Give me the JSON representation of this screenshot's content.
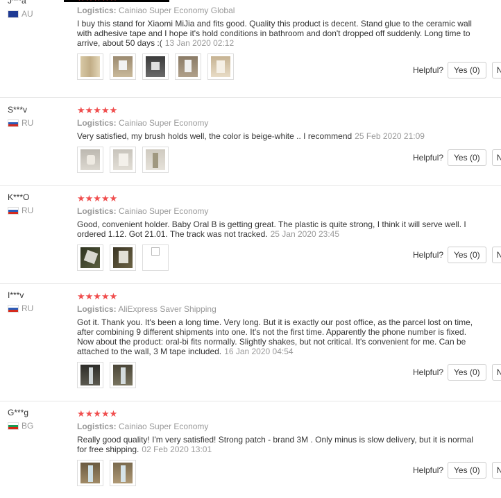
{
  "reviews": [
    {
      "user": "J***a",
      "country": "AU",
      "stars": "★★★★★",
      "logistics_label": "Logistics:",
      "logistics_value": "Cainiao Super Economy Global",
      "text": "I buy this stand for Xiaomi MiJia and fits good. Quality this product is decent. Stand glue to the ceramic wall with adhesive tape and I hope it's hold conditions in bathroom and don't dropped off suddenly. Long time to arrive, about 50 days :(",
      "date": "13 Jan 2020 02:12",
      "helpful": "Helpful?",
      "yes": "Yes (0)",
      "no": "No (0)"
    },
    {
      "user": "S***v",
      "country": "RU",
      "stars": "★★★★★",
      "logistics_label": "Logistics:",
      "logistics_value": "Cainiao Super Economy",
      "text": "Very satisfied, my brush holds well, the color is beige-white .. I recommend",
      "date": "25 Feb 2020 21:09",
      "helpful": "Helpful?",
      "yes": "Yes (0)",
      "no": "No (0)"
    },
    {
      "user": "K***O",
      "country": "RU",
      "stars": "★★★★★",
      "logistics_label": "Logistics:",
      "logistics_value": "Cainiao Super Economy",
      "text": "Good, convenient holder. Baby Oral B is getting great. The plastic is quite strong, I think it will serve well. I ordered 1.12. Got 21.01. The track was not tracked.",
      "date": "25 Jan 2020 23:45",
      "helpful": "Helpful?",
      "yes": "Yes (0)",
      "no": "No (0)"
    },
    {
      "user": "I***v",
      "country": "RU",
      "stars": "★★★★★",
      "logistics_label": "Logistics:",
      "logistics_value": "AliExpress Saver Shipping",
      "text": "Got it. Thank you. It's been a long time. Very long. But it is exactly our post office, as the parcel lost on time, after combining 9 different shipments into one. It's not the first time. Apparently the phone number is fixed. Now about the product: oral-bi fits normally. Slightly shakes, but not critical. It's convenient for me. Can be attached to the wall, 3 M tape included.",
      "date": "16 Jan 2020 04:54",
      "helpful": "Helpful?",
      "yes": "Yes (0)",
      "no": "No (0)"
    },
    {
      "user": "G***g",
      "country": "BG",
      "stars": "★★★★★",
      "logistics_label": "Logistics:",
      "logistics_value": "Cainiao Super Economy",
      "text": "Really good quality! I'm very satisfied! Strong patch - brand 3M . Only minus is slow delivery, but it is normal for free shipping.",
      "date": "02 Feb 2020 13:01",
      "helpful": "Helpful?",
      "yes": "Yes (0)",
      "no": "No (0)"
    }
  ]
}
